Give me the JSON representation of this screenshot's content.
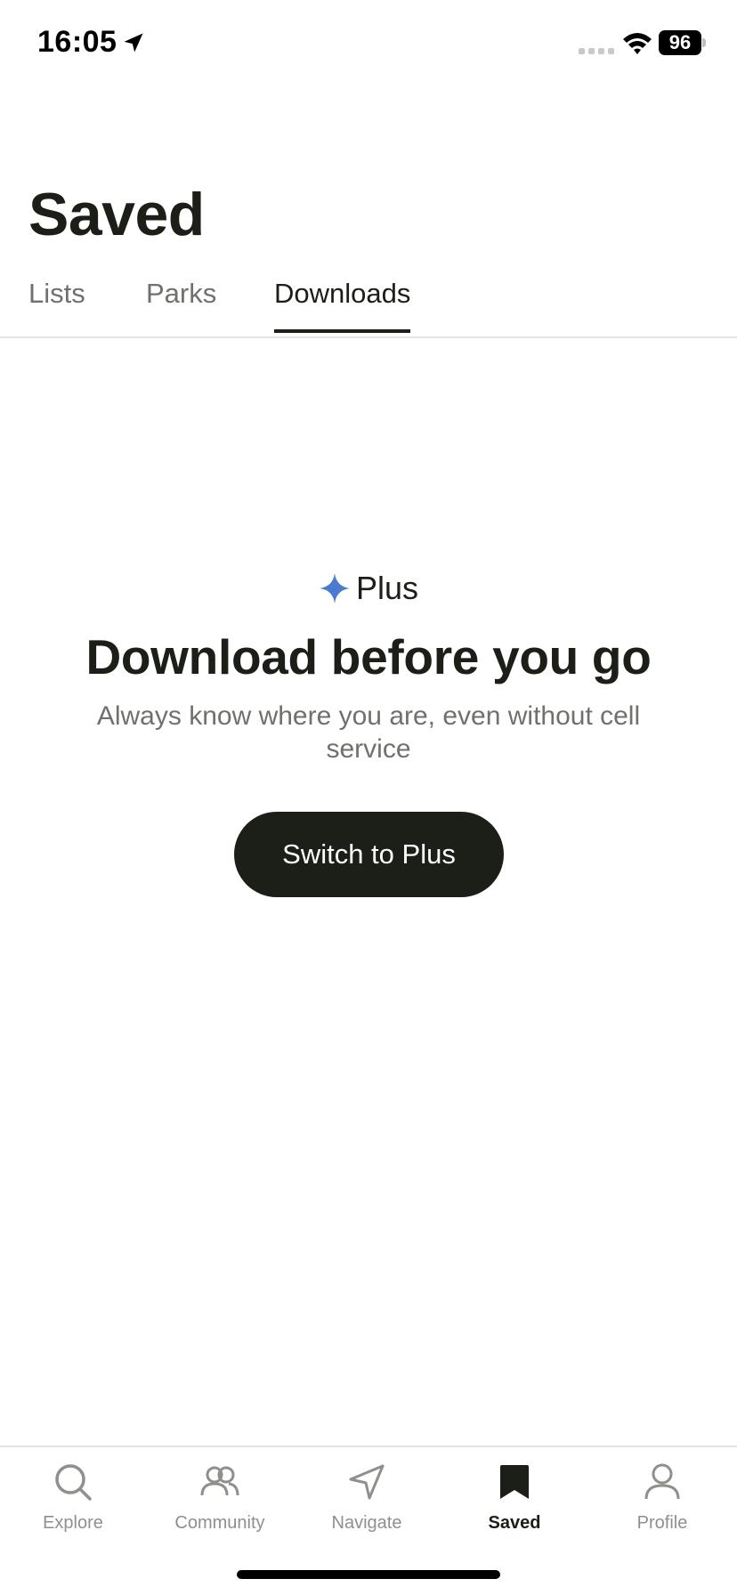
{
  "status_bar": {
    "time": "16:05",
    "battery": "96",
    "icons": [
      "location-arrow-icon",
      "signal-icon",
      "wifi-icon",
      "battery-icon"
    ]
  },
  "header": {
    "title": "Saved"
  },
  "tabs": [
    {
      "label": "Lists",
      "active": false
    },
    {
      "label": "Parks",
      "active": false
    },
    {
      "label": "Downloads",
      "active": true
    }
  ],
  "promo": {
    "badge_icon": "sparkle-icon",
    "badge_label": "Plus",
    "heading": "Download before you go",
    "subtitle": "Always know where you are, even without cell service",
    "button_label": "Switch to Plus"
  },
  "bottom_nav": [
    {
      "label": "Explore",
      "icon": "search-icon",
      "active": false
    },
    {
      "label": "Community",
      "icon": "people-icon",
      "active": false
    },
    {
      "label": "Navigate",
      "icon": "navigate-arrow-icon",
      "active": false
    },
    {
      "label": "Saved",
      "icon": "bookmark-icon",
      "active": true
    },
    {
      "label": "Profile",
      "icon": "person-icon",
      "active": false
    }
  ],
  "colors": {
    "primary_text": "#1b1f17",
    "secondary_text": "#6f716c",
    "inactive_nav": "#8e908b",
    "sparkle": "#4a7bd0",
    "button_bg": "#1b1f17",
    "divider": "#e4e4e2"
  }
}
